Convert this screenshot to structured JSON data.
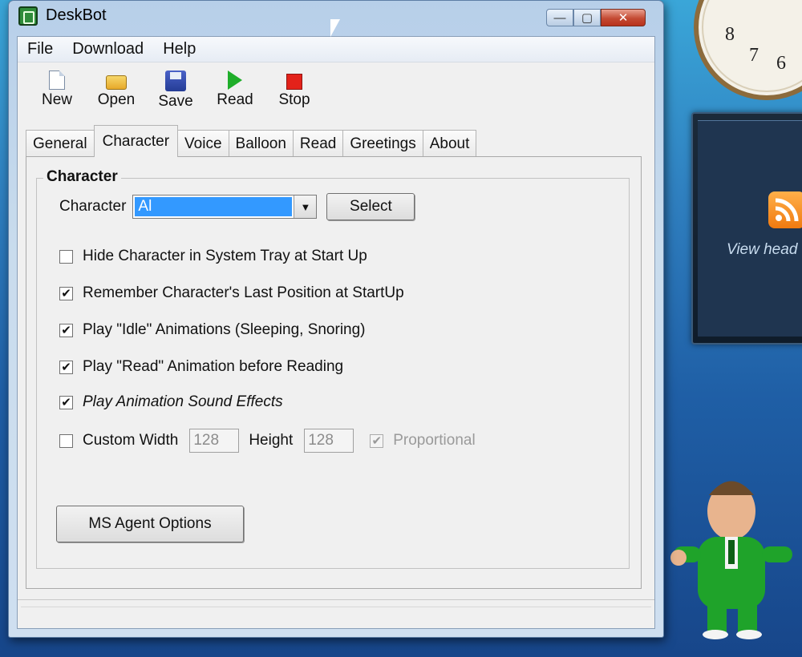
{
  "window": {
    "title": "DeskBot",
    "caption_buttons": {
      "minimize": "—",
      "maximize": "▢",
      "close": "✕"
    }
  },
  "menu": [
    "File",
    "Download",
    "Help"
  ],
  "toolbar": [
    {
      "label": "New",
      "icon": "new-document-icon"
    },
    {
      "label": "Open",
      "icon": "open-folder-icon"
    },
    {
      "label": "Save",
      "icon": "save-disk-icon"
    },
    {
      "label": "Read",
      "icon": "play-icon"
    },
    {
      "label": "Stop",
      "icon": "stop-icon"
    }
  ],
  "tabs": [
    "General",
    "Character",
    "Voice",
    "Balloon",
    "Read",
    "Greetings",
    "About"
  ],
  "active_tab": "Character",
  "character_group": {
    "title": "Character",
    "character_label": "Character",
    "character_value": "Al",
    "select_button": "Select",
    "options": [
      {
        "label": "Hide Character in System Tray at Start Up",
        "checked": false
      },
      {
        "label": "Remember Character's Last Position at StartUp",
        "checked": true
      },
      {
        "label": "Play \"Idle\" Animations (Sleeping, Snoring)",
        "checked": true
      },
      {
        "label": "Play \"Read\" Animation before Reading",
        "checked": true
      },
      {
        "label": "Play Animation Sound Effects",
        "checked": true
      }
    ],
    "custom_width": {
      "label": "Custom Width",
      "checked": false,
      "value": "128"
    },
    "height": {
      "label": "Height",
      "value": "128"
    },
    "proportional": {
      "label": "Proportional",
      "checked": true,
      "enabled": false
    },
    "ms_agent_button": "MS Agent Options"
  },
  "desktop": {
    "rss_text": "View head",
    "clock_numbers": [
      "8",
      "7",
      "6"
    ]
  },
  "colors": {
    "selection": "#3399ff",
    "desktop_blue": "#1f5fa6"
  }
}
